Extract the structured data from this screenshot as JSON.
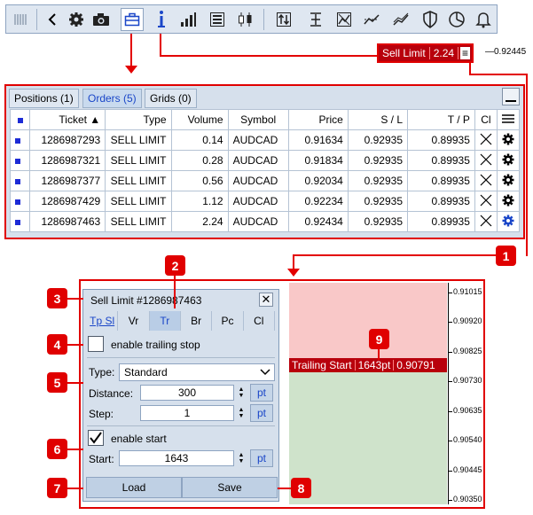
{
  "toolbar": {
    "items": [
      {
        "icon": "grip-icon"
      },
      {
        "icon": "back-arrow-icon"
      },
      {
        "icon": "gear-icon"
      },
      {
        "icon": "camera-icon"
      },
      {
        "icon": "briefcase-icon"
      },
      {
        "icon": "info-icon"
      },
      {
        "icon": "signal-bars-icon"
      },
      {
        "icon": "list-icon"
      },
      {
        "icon": "candles-icon"
      },
      {
        "icon": "sort-arrows-icon"
      },
      {
        "icon": "level-icon"
      },
      {
        "icon": "chart-window-icon"
      },
      {
        "icon": "trend-icon"
      },
      {
        "icon": "trailing-icon"
      },
      {
        "icon": "shield-icon"
      },
      {
        "icon": "pie-icon"
      },
      {
        "icon": "bell-icon"
      }
    ]
  },
  "sell_tag": {
    "label": "Sell Limit",
    "volume": "2.24",
    "menu": "≡",
    "price": "0.92445"
  },
  "panel": {
    "tabs": [
      {
        "label": "Positions (1)"
      },
      {
        "label": "Orders (5)"
      },
      {
        "label": "Grids (0)"
      }
    ],
    "columns": [
      "Ticket ▲",
      "Type",
      "Volume",
      "Symbol",
      "Price",
      "S / L",
      "T / P",
      "Cl"
    ],
    "rows": [
      {
        "ticket": "1286987293",
        "type": "SELL LIMIT",
        "volume": "0.14",
        "symbol": "AUDCAD",
        "price": "0.91634",
        "sl": "0.92935",
        "tp": "0.89935"
      },
      {
        "ticket": "1286987321",
        "type": "SELL LIMIT",
        "volume": "0.28",
        "symbol": "AUDCAD",
        "price": "0.91834",
        "sl": "0.92935",
        "tp": "0.89935"
      },
      {
        "ticket": "1286987377",
        "type": "SELL LIMIT",
        "volume": "0.56",
        "symbol": "AUDCAD",
        "price": "0.92034",
        "sl": "0.92935",
        "tp": "0.89935"
      },
      {
        "ticket": "1286987429",
        "type": "SELL LIMIT",
        "volume": "1.12",
        "symbol": "AUDCAD",
        "price": "0.92234",
        "sl": "0.92935",
        "tp": "0.89935"
      },
      {
        "ticket": "1286987463",
        "type": "SELL LIMIT",
        "volume": "2.24",
        "symbol": "AUDCAD",
        "price": "0.92434",
        "sl": "0.92935",
        "tp": "0.89935"
      }
    ]
  },
  "badges": {
    "b1": "1",
    "b2": "2",
    "b3": "3",
    "b4": "4",
    "b5": "5",
    "b6": "6",
    "b7": "7",
    "b8": "8",
    "b9": "9"
  },
  "dialog": {
    "title": "Sell Limit  #1286987463",
    "tabs": [
      "Tp Sl",
      "Vr",
      "Tr",
      "Br",
      "Pc",
      "Cl"
    ],
    "trailing_label": "enable trailing stop",
    "type_label": "Type:",
    "type_value": "Standard",
    "distance_label": "Distance:",
    "distance_value": "300",
    "step_label": "Step:",
    "step_value": "1",
    "unit": "pt",
    "start_enable_label": "enable start",
    "start_label": "Start:",
    "start_value": "1643",
    "load_label": "Load",
    "save_label": "Save"
  },
  "chart": {
    "trail_label": "Trailing Start",
    "trail_points": "1643pt",
    "trail_price": "0.90791",
    "y_labels": [
      "0.91015",
      "0.90920",
      "0.90825",
      "0.90730",
      "0.90635",
      "0.90540",
      "0.90445",
      "0.90350"
    ],
    "colors": {
      "above": "#f9c8c8",
      "below": "#cfe3cb",
      "accent": "#e00000"
    }
  }
}
